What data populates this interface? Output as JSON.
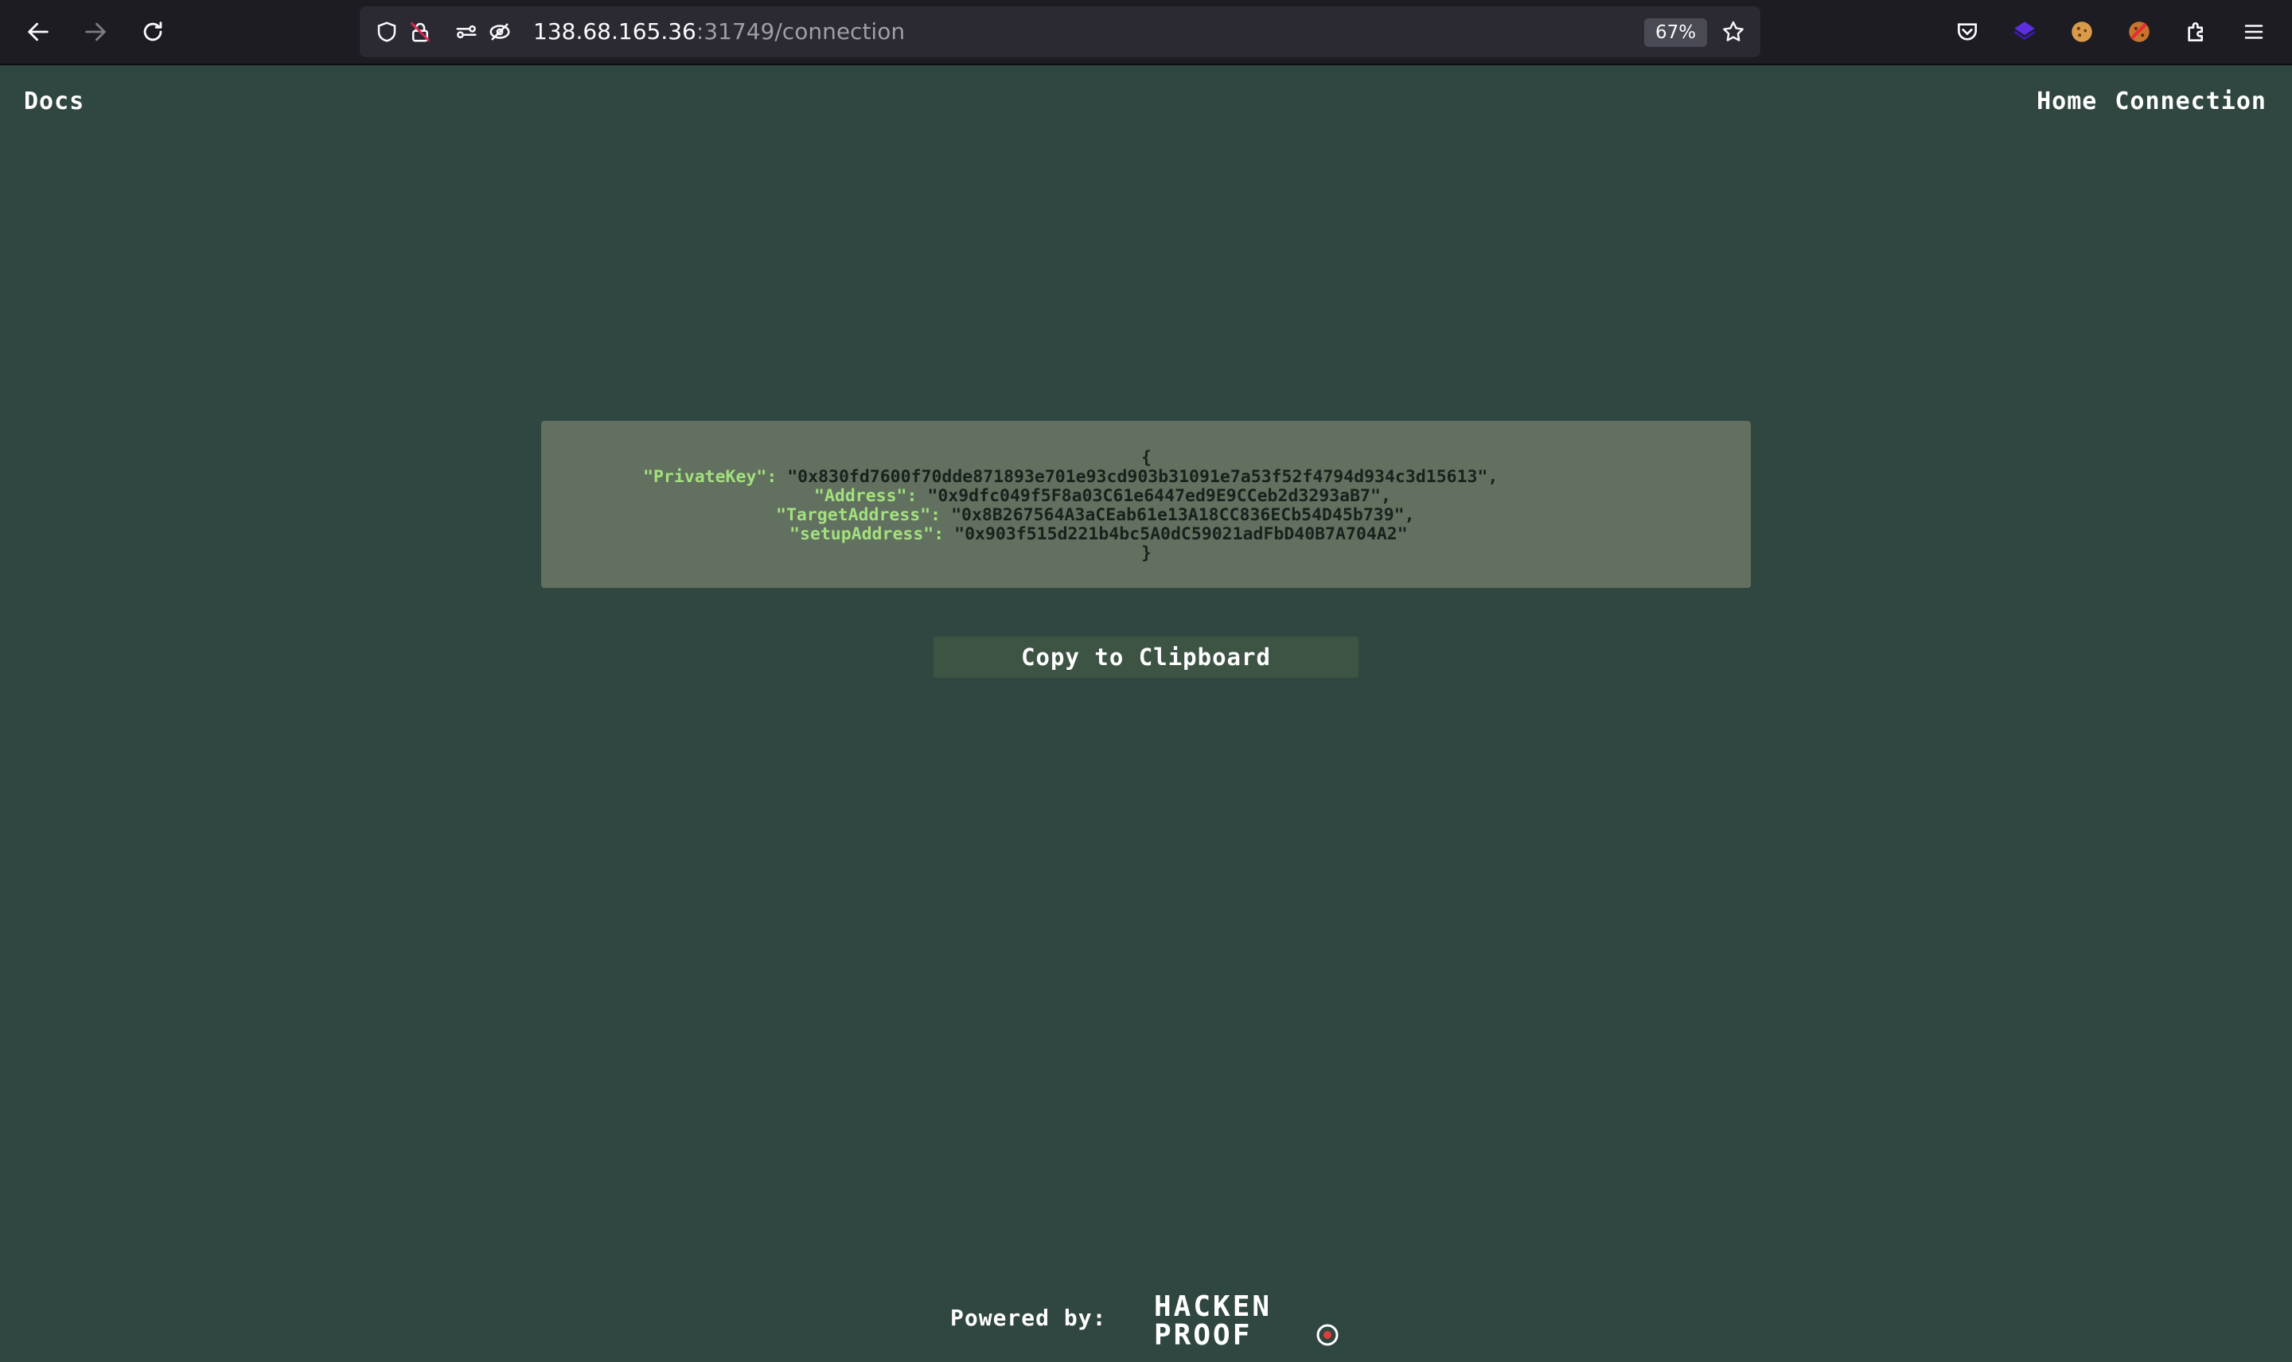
{
  "browser": {
    "url_host": "138.68.165.36",
    "url_rest": ":31749/connection",
    "zoom": "67%"
  },
  "nav": {
    "docs": "Docs",
    "home": "Home",
    "connection": "Connection"
  },
  "json_view": {
    "open_brace": "{",
    "close_brace": "}",
    "lines": [
      {
        "key": "\"PrivateKey\":",
        "value": "\"0x830fd7600f70dde871893e701e93cd903b31091e7a53f52f4794d934c3d15613\","
      },
      {
        "key": "\"Address\":",
        "value": "\"0x9dfc049f5F8a03C61e6447ed9E9CCeb2d3293aB7\","
      },
      {
        "key": "\"TargetAddress\":",
        "value": "\"0x8B267564A3aCEab61e13A18CC836ECb54D45b739\","
      },
      {
        "key": "\"setupAddress\":",
        "value": "\"0x903f515d221b4bc5A0dC59021adFbD40B7A704A2\""
      }
    ]
  },
  "copy_button": "Copy to Clipboard",
  "footer": {
    "powered_by": "Powered by:",
    "logo_line1": "HACKEN",
    "logo_line2": "PROOF"
  }
}
